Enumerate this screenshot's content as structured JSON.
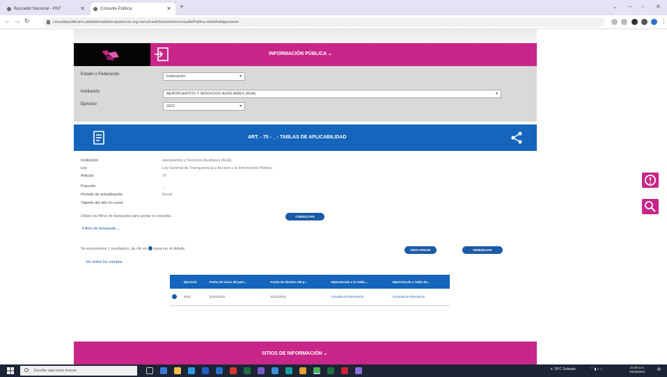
{
  "browser": {
    "tabs": [
      {
        "label": "Buscador Nacional - PNT",
        "active": false
      },
      {
        "label": "Consulta Pública",
        "active": true
      }
    ],
    "url": "consultapublicamx.plataformadetransparencia.org.mx/vut-web/faces/view/consultaPublica.xhtml#obligaciones"
  },
  "header": {
    "title": "INFORMACIÓN PÚBLICA ⌄"
  },
  "filters": {
    "estado": {
      "label": "Estado o Federación",
      "value": "Federación"
    },
    "institucion": {
      "label": "Institución",
      "value": "AEROPUERTOS Y SERVICIOS AUXILIARES (ASA)"
    },
    "ejercicio": {
      "label": "Ejercicio",
      "value": "2022"
    }
  },
  "section": {
    "title": "ART. - 70 - _ - TABLAS DE APLICABILIDAD"
  },
  "details": [
    {
      "label": "Institución",
      "value": "Aeropuertos y Servicios Auxiliares (ASA)"
    },
    {
      "label": "Ley",
      "value": "Ley General de Transparencia y Acceso a la Información Pública"
    },
    {
      "label": "Artículo",
      "value": "70"
    },
    {
      "label": "Fracción",
      "value": "_"
    },
    {
      "label": "Periodo de actualización",
      "value": "Anual"
    },
    {
      "label": "Vigente del año en curso",
      "value": ""
    }
  ],
  "search": {
    "hint": "Utiliza los filtros de búsqueda para acotar tu consulta",
    "consultar_label": "CONSULTAR",
    "filters_link": "Filtros de búsqueda ⌄"
  },
  "results": {
    "found_text": "Se encontraron 1 resultados, da clic en",
    "found_suffix": "para ver el detalle.",
    "download_label": "DESCARGAR",
    "report_label": "DENUNCIAR",
    "all_fields_link": "Ver todos los campos"
  },
  "table": {
    "columns": [
      "Ejercicio",
      "Fecha de inicio del peri...",
      "Fecha de término del p...",
      "Hipervínculo a la Tabla ...",
      "Hipervínculo a Tabla de..."
    ],
    "rows": [
      {
        "ejercicio": "2022",
        "inicio": "01/01/2022",
        "termino": "31/12/2022",
        "hiper1": "Consulta la información",
        "hiper2": "Consulta la información"
      }
    ]
  },
  "footer": {
    "title": "SITIOS DE INFORMACIÓN ⌄"
  },
  "taskbar": {
    "search_placeholder": "Escribe aquí para buscar",
    "weather": "29°C Soleado",
    "time": "10:29 a.m.",
    "date": "20/06/2022"
  },
  "colors": {
    "magenta": "#c9268a",
    "blue": "#1465bb",
    "gray_panel": "#d9d9d9"
  }
}
